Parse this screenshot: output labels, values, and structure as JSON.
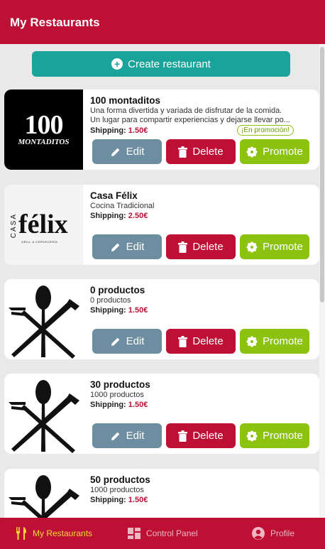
{
  "header": {
    "title": "My Restaurants"
  },
  "create_button": {
    "label": "Create restaurant"
  },
  "actions": {
    "edit": "Edit",
    "delete": "Delete",
    "promote": "Promote"
  },
  "shipping_label": "Shipping:",
  "restaurants": [
    {
      "name": "100 montaditos",
      "description_lines": [
        "Una forma divertida y variada de disfrutar de la comida.",
        "Un lugar para compartir experiencias y dejarse llevar po..."
      ],
      "shipping": "1.50€",
      "promo_badge": "¡En promoción!",
      "logo_text": {
        "big": "100",
        "small": "MONTADITOS"
      }
    },
    {
      "name": "Casa Félix",
      "description_lines": [
        "Cocina Tradicional"
      ],
      "shipping": "2.50€",
      "logo_text": {
        "casa": "CASA",
        "main": "félix",
        "sub": "GRILL & CERVECERÍA"
      }
    },
    {
      "name": "0 productos",
      "description_lines": [
        "0 productos"
      ],
      "shipping": "1.50€"
    },
    {
      "name": "30 productos",
      "description_lines": [
        "1000 productos"
      ],
      "shipping": "1.50€"
    },
    {
      "name": "50 productos",
      "description_lines": [
        "1000 productos"
      ],
      "shipping": "1.50€"
    }
  ],
  "tabs": [
    {
      "label": "My Restaurants",
      "icon": "cutlery-icon",
      "active": true
    },
    {
      "label": "Control Panel",
      "icon": "dashboard-icon",
      "active": false
    },
    {
      "label": "Profile",
      "icon": "user-icon",
      "active": false
    }
  ],
  "colors": {
    "brand": "#be0f34",
    "teal": "#1aa39a",
    "edit": "#6d8da1",
    "promote": "#8cc210",
    "active_tab": "#f2d93a"
  }
}
